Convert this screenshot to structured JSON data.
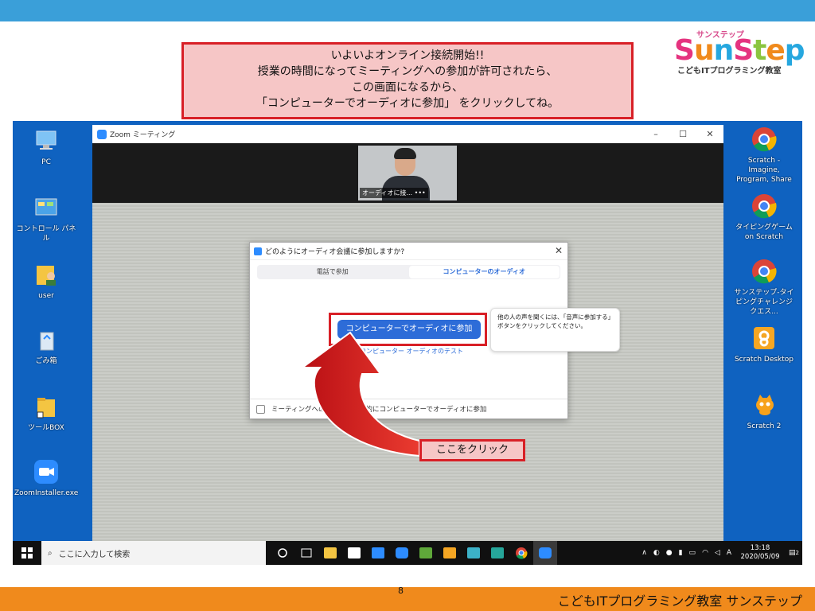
{
  "slide": {
    "callout_lines": [
      "いよいよオンライン接続開始!!",
      "授業の時間になってミーティングへの参加が許可されたら、",
      "この画面になるから、",
      "「コンピューターでオーディオに参加」 をクリックしてね。"
    ],
    "logo_top": "サンステップ",
    "logo_letters": [
      "S",
      "u",
      "n",
      "S",
      "t",
      "e",
      "p"
    ],
    "logo_sub": "こどもITプログラミング教室",
    "page_number": "8",
    "footer": "こどもITプログラミング教室 サンステップ",
    "click_label": "ここをクリック",
    "colors": {
      "top_bar": "#3a9fd9",
      "bottom_bar": "#f08a1c",
      "highlight": "#d81f26",
      "callout_bg": "#f6c6c6",
      "zoom_blue": "#2d6cd8"
    }
  },
  "desktop": {
    "left_icons": [
      {
        "label": "PC",
        "icon": "pc-icon"
      },
      {
        "label": "コントロール パネル",
        "icon": "control-panel-icon"
      },
      {
        "label": "user",
        "icon": "user-folder-icon"
      },
      {
        "label": "ごみ箱",
        "icon": "recycle-bin-icon"
      },
      {
        "label": "ツールBOX",
        "icon": "folder-icon"
      },
      {
        "label": "ZoomInstaller.exe",
        "icon": "zoom-installer-icon"
      }
    ],
    "right_icons": [
      {
        "label": "Scratch - Imagine, Program, Share",
        "icon": "chrome-icon"
      },
      {
        "label": "タイピングゲーム on Scratch",
        "icon": "chrome-icon"
      },
      {
        "label": "サンステップ-タイピングチャレンジクエス...",
        "icon": "chrome-icon"
      },
      {
        "label": "Scratch Desktop",
        "icon": "scratch-desktop-icon"
      },
      {
        "label": "Scratch 2",
        "icon": "scratch-cat-icon"
      }
    ]
  },
  "zoom": {
    "window_title": "Zoom ミーティング",
    "video_label": "オーディオに接...",
    "dialog": {
      "title": "どのようにオーディオ会議に参加しますか?",
      "tabs": [
        "電話で参加",
        "コンピューターのオーディオ"
      ],
      "join_button": "コンピューターでオーディオに参加",
      "test_link": "コンピューター オーディオのテスト",
      "tooltip": "他の人の声を聞くには、「音声に参加する」ボタンをクリックしてください。",
      "auto_join_checkbox": "ミーティングへの参加時に自動的にコンピューターでオーディオに参加"
    }
  },
  "taskbar": {
    "search_placeholder": "ここに入力して検索",
    "time": "13:18",
    "date": "2020/05/09",
    "ime": "A",
    "notification_count": "2"
  }
}
